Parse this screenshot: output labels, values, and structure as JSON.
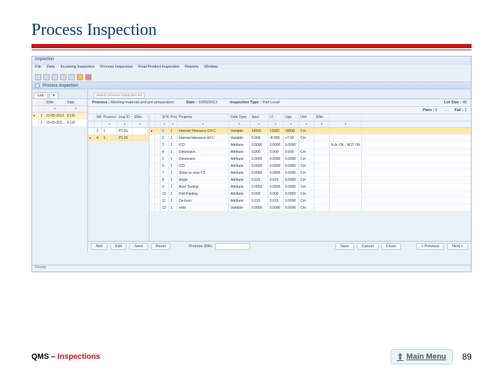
{
  "slide": {
    "title": "Process Inspection",
    "footer_prefix": "QMS – ",
    "footer_section": "Inspections",
    "main_menu": "Main Menu",
    "page_number": "89"
  },
  "app": {
    "window_title": "Inspection",
    "menus": [
      "File",
      "Data",
      "Incoming Inspection",
      "Process Inspection",
      "Final Product Inspection",
      "Reports",
      "Window"
    ],
    "panel_title": "Process Inspection",
    "tabs": {
      "active": "List",
      "search_placeholder": "search process inspection list"
    },
    "info": {
      "process_label": "Process :",
      "process_value": "Meeting material and pre-preparation",
      "date_label": "Date :",
      "date_value": "10/05/2013",
      "insp_type_label": "Inspection Type :",
      "insp_type_value": "Part Level",
      "lotsize_label": "Lot Size :",
      "lotsize_value": "48",
      "pass_label": "Pass :",
      "pass_value": "5",
      "fail_label": "Fail :",
      "fail_value": "1",
      "dots": "..."
    },
    "left_grid": {
      "headers": [
        "",
        "SlNo",
        "Date"
      ],
      "rows": [
        {
          "sl": "1",
          "date": "10-05-2013",
          "ext": "E110",
          "sel": true
        },
        {
          "sl": "2",
          "date": "10-05-201...",
          "ext": "E110",
          "sel": false
        }
      ]
    },
    "mid_grid": {
      "headers": [
        "SlNo",
        "Process SlNo",
        "Insp ID",
        "SlNo"
      ],
      "rows": [
        {
          "a": "3",
          "b": "1",
          "c": "P1-01",
          "sel": false
        },
        {
          "a": "4",
          "b": "1",
          "c": "P1-01",
          "sel": true
        }
      ]
    },
    "main_grid": {
      "headers": [
        "Sl N.",
        "Process SlNo",
        "Property",
        "Data Type",
        "Spec",
        "LT.",
        "Upp.",
        "Unit",
        "SlNo"
      ],
      "rows": [
        {
          "n": "1",
          "p": "1",
          "prop": "Internal Tolerance Drf C",
          "type": "Variable",
          "spec": "14000",
          "lt": "12000",
          "up": "16000",
          "unit": "Cm",
          "rem": "",
          "sel": true
        },
        {
          "n": "2",
          "p": "1",
          "prop": "Internal tolerance drf C",
          "type": "Variable",
          "spec": "0.000",
          "lt": "-8.000",
          "up": "+7.00",
          "unit": "Cm",
          "rem": ""
        },
        {
          "n": "3",
          "p": "1",
          "prop": "ICD",
          "type": "Attribute",
          "spec": "0.0000",
          "lt": "0.0000",
          "up": "0.0000",
          "unit": "",
          "rem": "N.A. OK ; NOT OK"
        },
        {
          "n": "4",
          "p": "1",
          "prop": "Dimension",
          "type": "Attribute",
          "spec": "0.000",
          "lt": "0.000",
          "up": "0.000",
          "unit": "Cm",
          "rem": ""
        },
        {
          "n": "5",
          "p": "1",
          "prop": "Dimension",
          "type": "Attribute",
          "spec": "0.0000",
          "lt": "0.0000",
          "up": "0.0000",
          "unit": "Cm",
          "rem": ""
        },
        {
          "n": "6",
          "p": "1",
          "prop": "ICD",
          "type": "Attribute",
          "spec": "0.0000",
          "lt": "0.0000",
          "up": "0.0000",
          "unit": "Cm",
          "rem": ""
        },
        {
          "n": "7",
          "p": "1",
          "prop": "Slope to view C3",
          "type": "Attribute",
          "spec": "0.0000",
          "lt": "0.0000",
          "up": "0.0000",
          "unit": "Cm",
          "rem": ""
        },
        {
          "n": "8",
          "p": "1",
          "prop": "Angle",
          "type": "Attribute",
          "spec": "0.015",
          "lt": "0.015",
          "up": "0.0000",
          "unit": "Cm",
          "rem": ""
        },
        {
          "n": "9",
          "p": "1",
          "prop": "Burn Texting",
          "type": "Attribute",
          "spec": "0.0000",
          "lt": "0.0000",
          "up": "0.0000",
          "unit": "Cm",
          "rem": ""
        },
        {
          "n": "10",
          "p": "1",
          "prop": "Hull Panting",
          "type": "Attribute",
          "spec": "0.000",
          "lt": "0.000",
          "up": "0.0000",
          "unit": "Cm",
          "rem": ""
        },
        {
          "n": "11",
          "p": "1",
          "prop": "De-burri",
          "type": "Attribute",
          "spec": "0.015",
          "lt": "0.015",
          "up": "0.0000",
          "unit": "Cm",
          "rem": ""
        },
        {
          "n": "12",
          "p": "1",
          "prop": "ortid",
          "type": "Variable",
          "spec": "0.0000",
          "lt": "0.0000",
          "up": "0.0000",
          "unit": "Cm",
          "rem": ""
        }
      ]
    },
    "buttons": {
      "left": [
        "Add",
        "Edit",
        "Save",
        "Reset"
      ],
      "process_sno_label": "Process SlNo",
      "mid": [
        "Save",
        "Cancel",
        "Close"
      ],
      "nav": [
        "< Previous",
        "Next >"
      ]
    },
    "statusbar": "Ready"
  }
}
